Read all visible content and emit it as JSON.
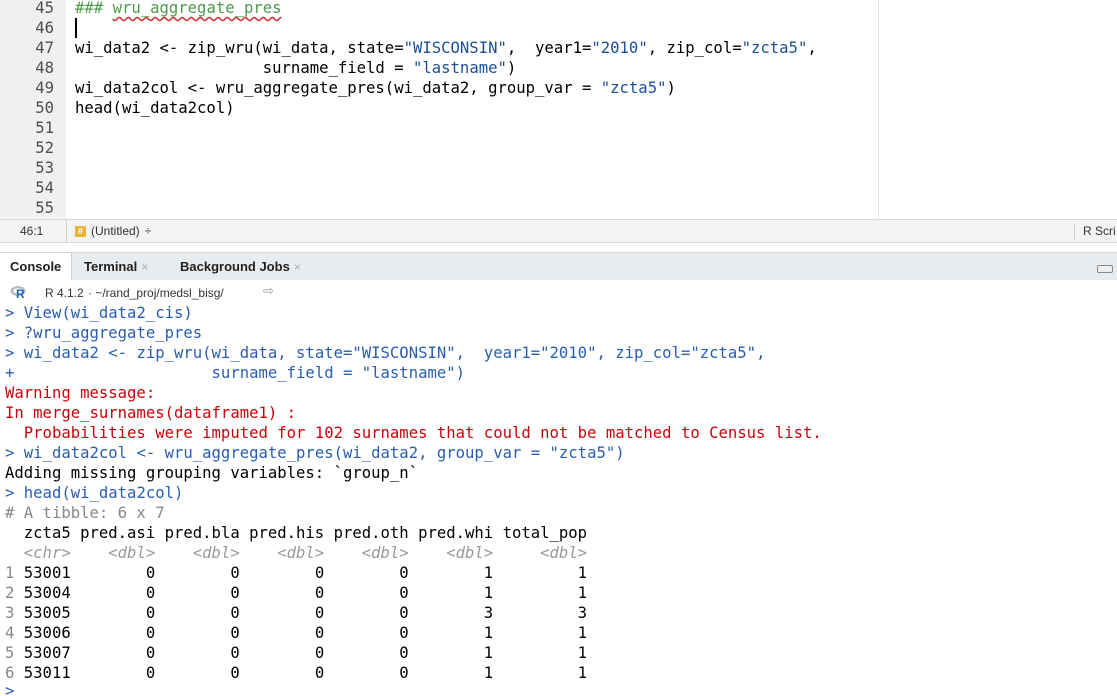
{
  "editor": {
    "line_numbers": [
      "45",
      "46",
      "47",
      "48",
      "49",
      "50",
      "51",
      "52",
      "53",
      "54",
      "55"
    ],
    "lines": {
      "l45_prefix": "### ",
      "l45_word": "wru_aggregate_pres",
      "l47_a": "wi_data2 <- zip_wru(wi_data, state=",
      "l47_s1": "\"WISCONSIN\"",
      "l47_b": ",  year1=",
      "l47_s2": "\"2010\"",
      "l47_c": ", zip_col=",
      "l47_s3": "\"zcta5\"",
      "l47_d": ",",
      "l48_a": "                    surname_field = ",
      "l48_s": "\"lastname\"",
      "l48_b": ")",
      "l49_a": "wi_data2col <- wru_aggregate_pres(wi_data2, group_var = ",
      "l49_s": "\"zcta5\"",
      "l49_b": ")",
      "l50": "head(wi_data2col)"
    }
  },
  "statusbar": {
    "position": "46:1",
    "scope": "(Untitled)",
    "scope_arrow": "÷",
    "filetype": "R Scri"
  },
  "tabs": {
    "console": "Console",
    "terminal": "Terminal",
    "background_jobs": "Background Jobs",
    "close": "×"
  },
  "console": {
    "r_version": "R 4.1.2",
    "cwd": "· ~/rand_proj/medsl_bisg/",
    "lines": {
      "c1_p": "> ",
      "c1": "View(wi_data2_cis)",
      "c2_p": "> ",
      "c2": "?wru_aggregate_pres",
      "c3_p": "> ",
      "c3": "wi_data2 <- zip_wru(wi_data, state=\"WISCONSIN\",  year1=\"2010\", zip_col=\"zcta5\",",
      "c4_p": "+ ",
      "c4": "                    surname_field = \"lastname\")",
      "c5": "Warning message:",
      "c6": "In merge_surnames(dataframe1) :",
      "c7": "  Probabilities were imputed for 102 surnames that could not be matched to Census list.",
      "c8_p": "> ",
      "c8": "wi_data2col <- wru_aggregate_pres(wi_data2, group_var = \"zcta5\")",
      "c9": "Adding missing grouping variables: `group_n`",
      "c10_p": "> ",
      "c10": "head(wi_data2col)",
      "c11": "# A tibble: 6 x 7",
      "c12": "  zcta5 pred.asi pred.bla pred.his pred.oth pred.whi total_pop",
      "c13": "  <chr>    <dbl>    <dbl>    <dbl>    <dbl>    <dbl>     <dbl>",
      "final_prompt": ">"
    },
    "table_rows": [
      {
        "idx": "1",
        "rest": " 53001        0        0        0        0        1         1"
      },
      {
        "idx": "2",
        "rest": " 53004        0        0        0        0        1         1"
      },
      {
        "idx": "3",
        "rest": " 53005        0        0        0        0        3         3"
      },
      {
        "idx": "4",
        "rest": " 53006        0        0        0        0        1         1"
      },
      {
        "idx": "5",
        "rest": " 53007        0        0        0        0        1         1"
      },
      {
        "idx": "6",
        "rest": " 53011        0        0        0        0        1         1"
      }
    ]
  },
  "colors": {
    "command": "#2a5db0",
    "error": "#c5060b",
    "string": "#1a4e99",
    "comment": "#4d9a4d"
  }
}
